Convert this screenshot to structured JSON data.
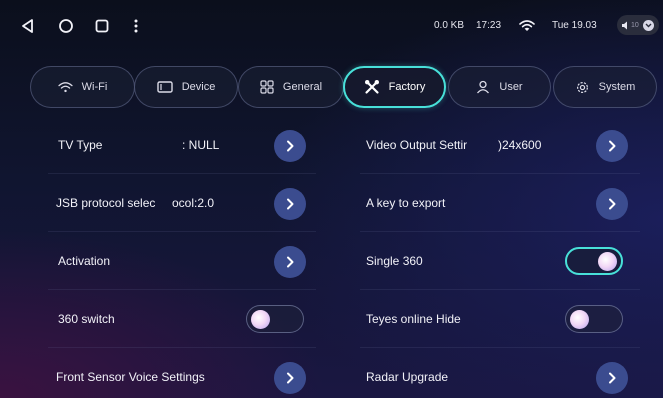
{
  "status_bar": {
    "data_counter": "0.0 KB",
    "time": "17:23",
    "date": "Tue 19.03",
    "volume_level": "10"
  },
  "tabs": [
    {
      "label": "Wi-Fi",
      "icon": "wifi-icon",
      "active": false
    },
    {
      "label": "Device",
      "icon": "device-icon",
      "active": false
    },
    {
      "label": "General",
      "icon": "grid-icon",
      "active": false
    },
    {
      "label": "Factory",
      "icon": "tools-icon",
      "active": true
    },
    {
      "label": "User",
      "icon": "user-icon",
      "active": false
    },
    {
      "label": "System",
      "icon": "gear-icon",
      "active": false
    }
  ],
  "settings": {
    "left": [
      {
        "label": "TV Type",
        "value": ": NULL",
        "control": "arrow"
      },
      {
        "label": "JSB protocol selec",
        "value": "ocol:2.0",
        "control": "arrow"
      },
      {
        "label": "Activation",
        "value": "",
        "control": "arrow"
      },
      {
        "label": "360 switch",
        "value": "",
        "control": "toggle",
        "state": "off"
      },
      {
        "label": "Front Sensor Voice Settings",
        "value": "",
        "control": "arrow"
      }
    ],
    "right": [
      {
        "label": "Video Output Settir",
        "value": ")24x600",
        "control": "arrow"
      },
      {
        "label": "A key to export",
        "value": "",
        "control": "arrow"
      },
      {
        "label": "Single 360",
        "value": "",
        "control": "toggle",
        "state": "on"
      },
      {
        "label": "Teyes online Hide",
        "value": "",
        "control": "toggle",
        "state": "off"
      },
      {
        "label": "Radar Upgrade",
        "value": "",
        "control": "arrow"
      }
    ]
  },
  "colors": {
    "accent": "#48e0d9",
    "arrow_button": "#3b4c8f"
  }
}
